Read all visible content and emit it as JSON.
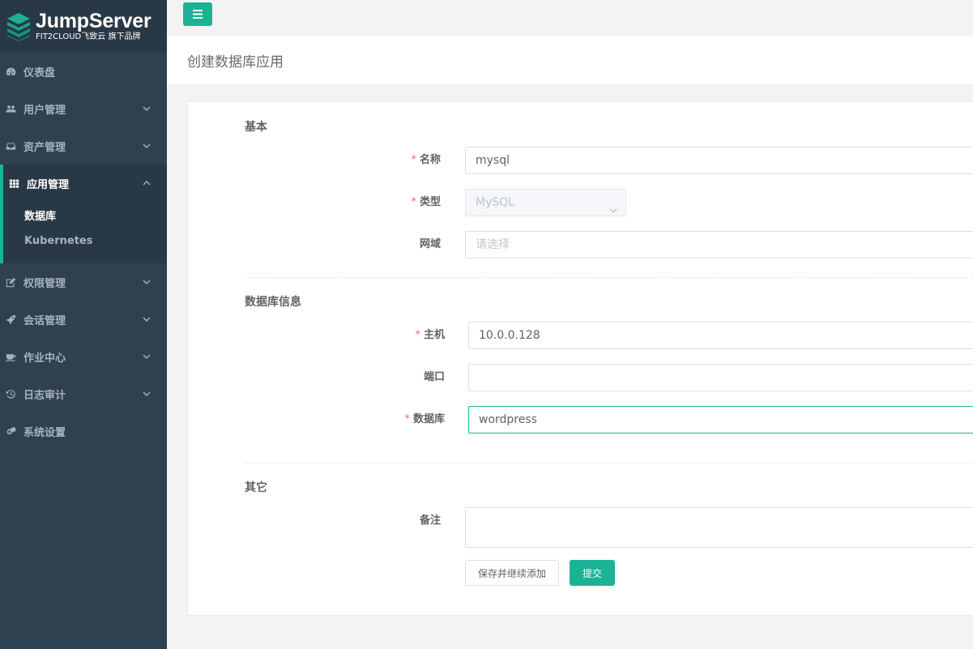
{
  "brand": {
    "title": "JumpServer",
    "subtitle": "FIT2CLOUD飞致云 旗下品牌",
    "accent": "#1ab394"
  },
  "sidebar": {
    "items": [
      {
        "label": "仪表盘",
        "icon": "dashboard-icon"
      },
      {
        "label": "用户管理",
        "icon": "users-icon"
      },
      {
        "label": "资产管理",
        "icon": "inbox-icon"
      },
      {
        "label": "应用管理",
        "icon": "grid-icon",
        "expanded": true,
        "children": [
          {
            "label": "数据库",
            "selected": true
          },
          {
            "label": "Kubernetes"
          }
        ]
      },
      {
        "label": "权限管理",
        "icon": "edit-icon"
      },
      {
        "label": "会话管理",
        "icon": "rocket-icon"
      },
      {
        "label": "作业中心",
        "icon": "coffee-icon"
      },
      {
        "label": "日志审计",
        "icon": "history-icon"
      },
      {
        "label": "系统设置",
        "icon": "gears-icon"
      }
    ]
  },
  "header": {
    "page_title": "创建数据库应用"
  },
  "form": {
    "sections": {
      "basic": "基本",
      "db_info": "数据库信息",
      "other": "其它"
    },
    "name": {
      "label": "名称",
      "value": "mysql"
    },
    "type": {
      "label": "类型",
      "value": "MySQL"
    },
    "domain": {
      "label": "网域",
      "placeholder": "请选择"
    },
    "host": {
      "label": "主机",
      "value": "10.0.0.128"
    },
    "port": {
      "label": "端口",
      "value": ""
    },
    "database": {
      "label": "数据库",
      "value": "wordpress"
    },
    "comment": {
      "label": "备注",
      "value": ""
    },
    "required_mark": "*",
    "buttons": {
      "save_continue": "保存并继续添加",
      "submit": "提交"
    }
  }
}
